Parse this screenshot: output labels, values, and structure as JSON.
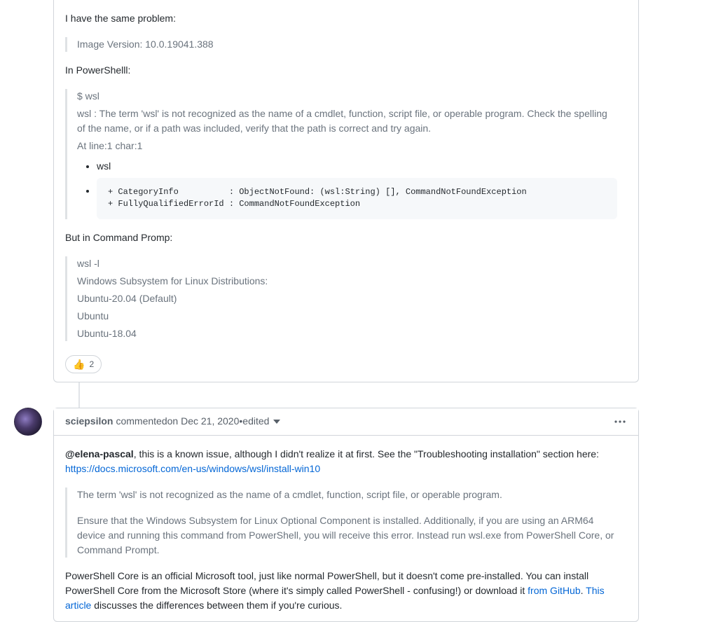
{
  "comment1": {
    "intro": "I have the same problem:",
    "bq1_line": "Image Version: 10.0.19041.388",
    "ps_label": "In PowerShelll:",
    "bq2_line1": "$ wsl",
    "bq2_line2": "wsl : The term 'wsl' is not recognized as the name of a cmdlet, function, script file, or operable program. Check the spelling of the name, or if a path was included, verify that the path is correct and try again.",
    "bq2_line3": "At line:1 char:1",
    "bq2_li1": "wsl",
    "bq2_code": "+ CategoryInfo          : ObjectNotFound: (wsl:String) [], CommandNotFoundException\n+ FullyQualifiedErrorId : CommandNotFoundException",
    "cmd_label": "But in Command Promp:",
    "bq3_line1": "wsl -l",
    "bq3_line2": "Windows Subsystem for Linux Distributions:",
    "bq3_line3": "Ubuntu-20.04 (Default)",
    "bq3_line4": "Ubuntu",
    "bq3_line5": "Ubuntu-18.04",
    "reaction_emoji": "👍",
    "reaction_count": "2"
  },
  "comment2": {
    "author": "sciepsilon",
    "commented": " commented ",
    "date": "on Dec 21, 2020",
    "edited_sep": " • ",
    "edited": "edited",
    "mention": "@elena-pascal",
    "line1_rest": ", this is a known issue, although I didn't realize it at first. See the \"Troubleshooting installation\" section here: ",
    "link_docs": "https://docs.microsoft.com/en-us/windows/wsl/install-win10",
    "bq_p1": "The term 'wsl' is not recognized as the name of a cmdlet, function, script file, or operable program.",
    "bq_p2": "Ensure that the Windows Subsystem for Linux Optional Component is installed. Additionally, if you are using an ARM64 device and running this command from PowerShell, you will receive this error. Instead run wsl.exe from PowerShell Core, or Command Prompt.",
    "p2_pre": "PowerShell Core is an official Microsoft tool, just like normal PowerShell, but it doesn't come pre-installed. You can install PowerShell Core from the Microsoft Store (where it's simply called PowerShell - confusing!) or download it ",
    "link_github": "from GitHub",
    "p2_mid": ". ",
    "link_article": "This article",
    "p2_post": " discusses the differences between them if you're curious."
  }
}
